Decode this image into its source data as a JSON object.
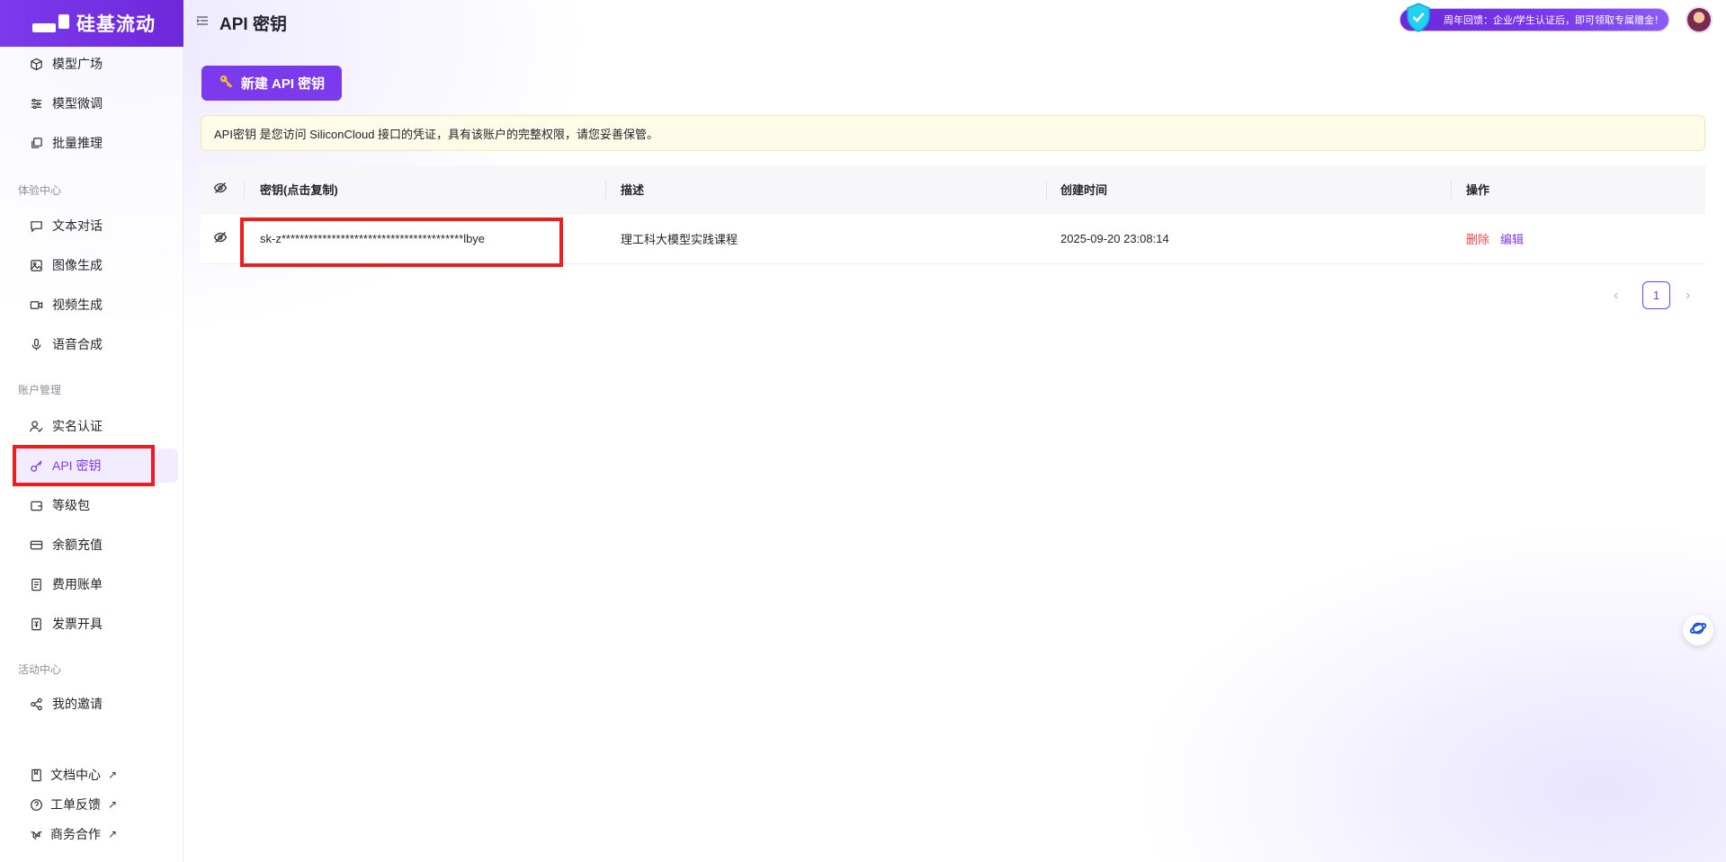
{
  "app": {
    "logo_text": "硅基流动",
    "page_title": "API 密钥",
    "promo_text": "周年回馈：企业/学生认证后，即可领取专属赠金！"
  },
  "sidebar": {
    "top_items": [
      {
        "label": "模型广场",
        "icon": "cube-icon"
      },
      {
        "label": "模型微调",
        "icon": "sliders-icon"
      },
      {
        "label": "批量推理",
        "icon": "batch-icon"
      }
    ],
    "sections": [
      {
        "title": "体验中心",
        "items": [
          {
            "label": "文本对话",
            "icon": "chat-icon"
          },
          {
            "label": "图像生成",
            "icon": "image-icon"
          },
          {
            "label": "视频生成",
            "icon": "video-icon"
          },
          {
            "label": "语音合成",
            "icon": "mic-icon"
          }
        ]
      },
      {
        "title": "账户管理",
        "items": [
          {
            "label": "实名认证",
            "icon": "user-check-icon"
          },
          {
            "label": "API 密钥",
            "icon": "key-icon",
            "active": true
          },
          {
            "label": "等级包",
            "icon": "wallet-icon"
          },
          {
            "label": "余额充值",
            "icon": "card-icon"
          },
          {
            "label": "费用账单",
            "icon": "bill-icon"
          },
          {
            "label": "发票开具",
            "icon": "invoice-icon"
          }
        ]
      },
      {
        "title": "活动中心",
        "items": [
          {
            "label": "我的邀请",
            "icon": "share-icon"
          }
        ]
      }
    ],
    "footer_links": [
      {
        "label": "文档中心",
        "arrow": "↗",
        "icon": "doc-icon"
      },
      {
        "label": "工单反馈",
        "arrow": "↗",
        "icon": "help-icon"
      },
      {
        "label": "商务合作",
        "arrow": "↗",
        "icon": "handshake-icon"
      }
    ]
  },
  "main": {
    "new_key_button": "新建 API 密钥",
    "notice": "API密钥 是您访问 SiliconCloud 接口的凭证，具有该账户的完整权限，请您妥善保管。",
    "table": {
      "headers": [
        "密钥(点击复制)",
        "描述",
        "创建时间",
        "操作"
      ],
      "rows": [
        {
          "key": "sk-z****************************************lbye",
          "description": "理工科大模型实践课程",
          "created": "2025-09-20 23:08:14",
          "delete_label": "删除",
          "edit_label": "编辑"
        }
      ]
    },
    "pagination": {
      "current_page": "1",
      "prev": "‹",
      "next": "›"
    }
  },
  "colors": {
    "accent": "#7c3aed",
    "danger": "#e5484d",
    "highlight_box": "#ee1c1c",
    "notice_bg": "#fefbe8"
  }
}
